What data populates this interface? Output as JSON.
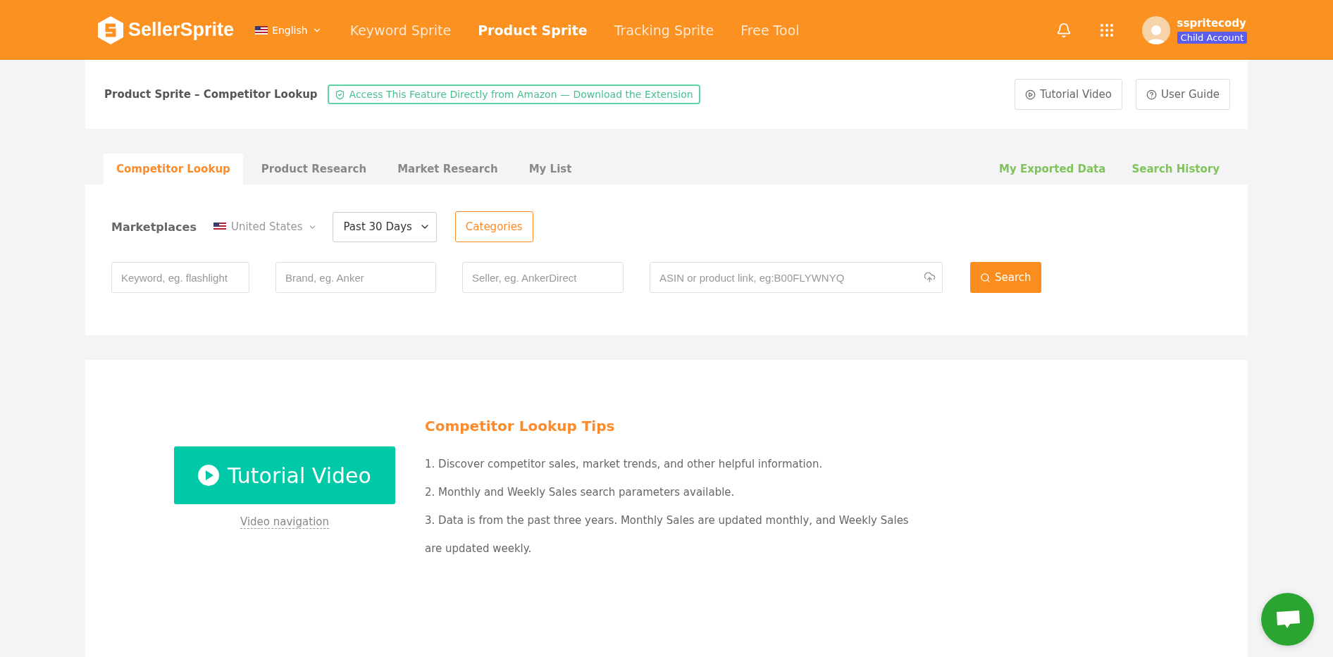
{
  "header": {
    "logo": "SellerSprite",
    "language": "English",
    "nav": [
      {
        "label": "Keyword Sprite",
        "selected": false
      },
      {
        "label": "Product Sprite",
        "selected": true
      },
      {
        "label": "Tracking Sprite",
        "selected": false
      },
      {
        "label": "Free Tool",
        "selected": false
      }
    ],
    "user": {
      "name": "sspritecody",
      "badge": "Child Account"
    }
  },
  "page_bar": {
    "title": "Product Sprite – Competitor Lookup",
    "banner": "Access This Feature Directly from Amazon — Download the Extension",
    "buttons": [
      {
        "kind": "video",
        "label": "Tutorial Video"
      },
      {
        "kind": "guide",
        "label": "User Guide"
      }
    ]
  },
  "tabs": [
    {
      "label": "Competitor Lookup",
      "selected": true
    },
    {
      "label": "Product Research",
      "selected": false
    },
    {
      "label": "Market Research",
      "selected": false
    },
    {
      "label": "My List",
      "selected": false
    }
  ],
  "tab_links": [
    "My Exported Data",
    "Search History"
  ],
  "filters": {
    "marketplaces_label": "Marketplaces",
    "marketplace": "United States",
    "period": "Past 30 Days",
    "categories": "Categories"
  },
  "search_fields": [
    {
      "kind": "text",
      "placeholder": "Keyword, eg. flashlight"
    },
    {
      "kind": "text",
      "placeholder": "Brand, eg. Anker"
    },
    {
      "kind": "text",
      "placeholder": "Seller, eg. AnkerDirect"
    },
    {
      "kind": "upload",
      "placeholder": "ASIN or product link, eg:B00FLYWNYQ"
    }
  ],
  "search_button": "Search",
  "tips": {
    "video_button": "Tutorial Video",
    "video_link": "Video navigation",
    "title": "Competitor Lookup Tips",
    "items": [
      "1. Discover competitor sales, market trends, and other helpful information.",
      "2. Monthly and Weekly Sales search parameters available.",
      "3. Data is from the past three years. Monthly Sales are updated monthly, and Weekly Sales are updated weekly."
    ]
  }
}
